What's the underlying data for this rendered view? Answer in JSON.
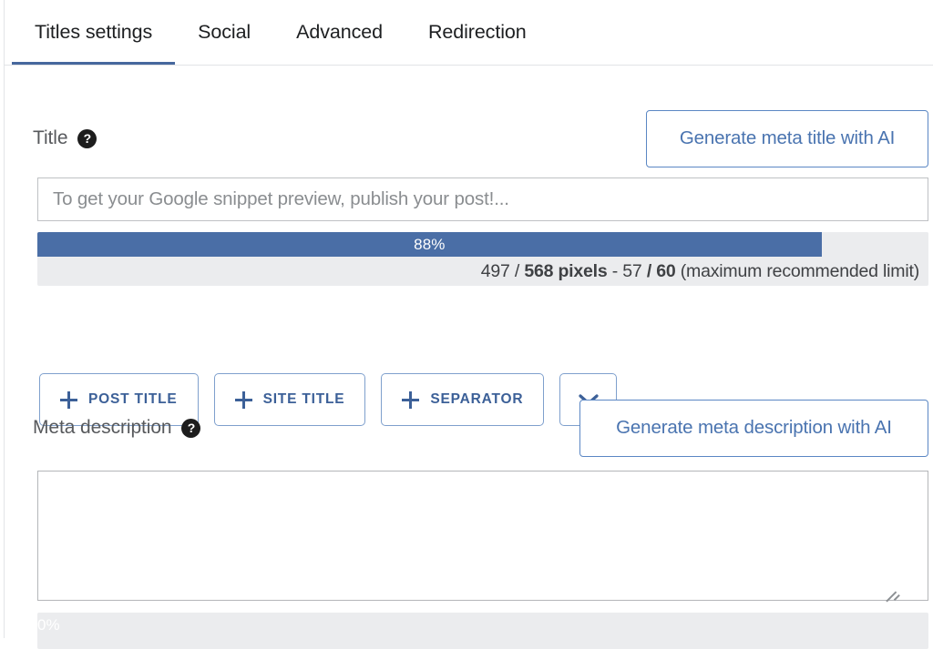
{
  "tabs": [
    {
      "label": "Titles settings",
      "active": true
    },
    {
      "label": "Social",
      "active": false
    },
    {
      "label": "Advanced",
      "active": false
    },
    {
      "label": "Redirection",
      "active": false
    }
  ],
  "title_section": {
    "label": "Title",
    "help_icon": "question-mark-icon",
    "help_glyph": "?",
    "ai_button": "Generate meta title with AI",
    "input_value": "",
    "input_placeholder": "To get your Google snippet preview, publish your post!...",
    "progress": {
      "percent_label": "88%",
      "percent_value": 88,
      "caption_plain_1": "497 / ",
      "caption_bold_1": "568 pixels",
      "caption_plain_2": " - 57 ",
      "caption_bold_2": "/ 60",
      "caption_plain_3": " (maximum recommended limit)"
    },
    "tag_buttons": [
      {
        "plus": "plus-icon",
        "label": "POST TITLE"
      },
      {
        "plus": "plus-icon",
        "label": "SITE TITLE"
      },
      {
        "plus": "plus-icon",
        "label": "SEPARATOR"
      }
    ],
    "more_button_icon": "chevron-down-icon"
  },
  "description_section": {
    "label": "Meta description",
    "help_icon": "question-mark-icon",
    "help_glyph": "?",
    "ai_button": "Generate meta description with AI",
    "textarea_value": "",
    "textarea_placeholder": "",
    "progress": {
      "percent_label": "0%",
      "percent_value": 0
    }
  },
  "colors": {
    "accent_blue": "#4a6ea6",
    "link_blue": "#4a74b0",
    "tag_blue": "#3c6098",
    "track_gray": "#ebecee",
    "border_gray": "#bfc1c4",
    "tab_underline": "#46689d"
  }
}
